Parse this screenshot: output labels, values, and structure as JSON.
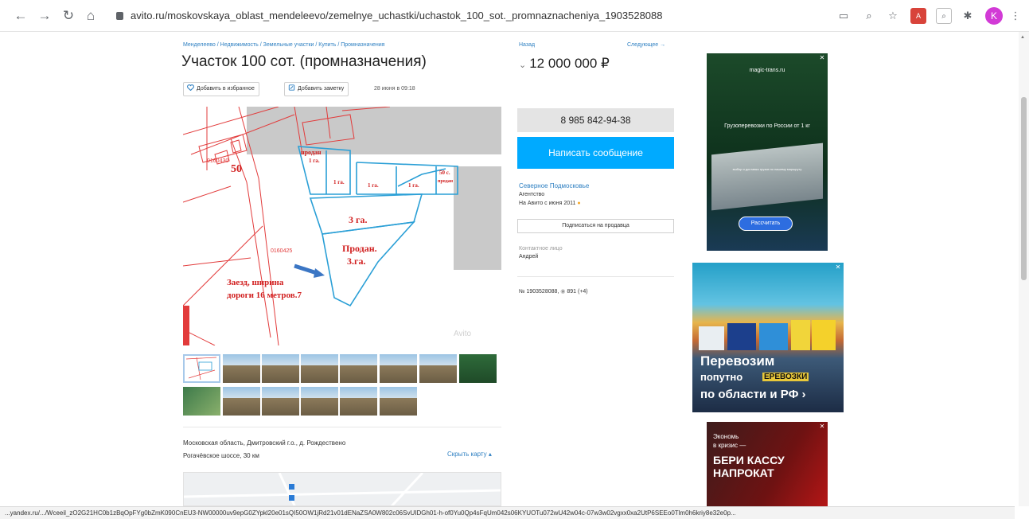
{
  "browser": {
    "url": "avito.ru/moskovskaya_oblast_mendeleevo/zemelnye_uchastki/uchastok_100_sot._promnaznacheniya_1903528088",
    "status_url": "...yandex.ru/.../Wceeil_zO2G21HC0b1zBqOpFYg0bZmK090CnEU3-NW00000uv9epG0ZYpkl20e01sQI50OW1jRd21v01dENaZSA0W802c06SvUIDGh01-h-of0Yu0Qp4sFqUm042s06KYUOTu072wU42w04c-07w3w02vgxx0xa2UtP6SEEo0Tlm0h6kriy8e32e0p...",
    "avatar_letter": "K"
  },
  "listing": {
    "breadcrumb": "Менделеево / Недвижимость / Земельные участки / Купить / Промназначения",
    "title": "Участок 100 сот. (промназначения)",
    "favorite_label": "Добавить в избранное",
    "note_label": "Добавить заметку",
    "date": "28 июня в 09:18",
    "watermark": "Avito",
    "address_line1": "Московская область, Дмитровский г.о., д. Рождествено",
    "address_line2": "Рогачёвское шоссе, 30 км",
    "hide_map": "Скрыть карту"
  },
  "map_labels": {
    "parcel_50": "50",
    "cad_left": "0160430",
    "cad_mid": "0160425",
    "sold_1ha": [
      "продан",
      "1 га."
    ],
    "ha_1": "1 га.",
    "sold_50": [
      "50 с.",
      "продан"
    ],
    "ha_3": "3 га.",
    "sold_3ha": [
      "Продан.",
      "3.га."
    ],
    "entrance": [
      "Заезд, ширина",
      "дороги 16 метров.7"
    ]
  },
  "sidebar": {
    "back": "Назад",
    "next": "Следующее",
    "price": "12 000 000 ₽",
    "phone": "8 985 842-94-38",
    "message": "Написать сообщение",
    "seller": "Северное Подмосковье",
    "seller_type": "Агентство",
    "on_avito": "На Авито с июня 2011",
    "subscribe": "Подписаться на продавца",
    "contact_label": "Контактное лицо",
    "contact_name": "Андрей",
    "ad_number": "№ 1903528088,",
    "views": "891 (+4)"
  },
  "ads": {
    "ad1_site": "magic-trans.ru",
    "ad1_text": "Грузоперевозки по России от 1 кг",
    "ad1_sub": "выбор и доставка грузов по нашему маршруту",
    "ad1_button": "Рассчитать",
    "ad2_line1": "Перевозим",
    "ad2_line2": "попутно",
    "ad2_line3": "по области и РФ ›",
    "ad2_overlay": "ЕРЕВОЗКИ",
    "ad3_small1": "Экономь",
    "ad3_small2": "в кризис —",
    "ad3_big1": "БЕРИ КАССУ",
    "ad3_big2": "НАПРОКАТ"
  },
  "colors": {
    "accent": "#00aaff",
    "link": "#2f80c2",
    "map_red": "#e23b3b",
    "map_blue": "#2a9fd6"
  }
}
